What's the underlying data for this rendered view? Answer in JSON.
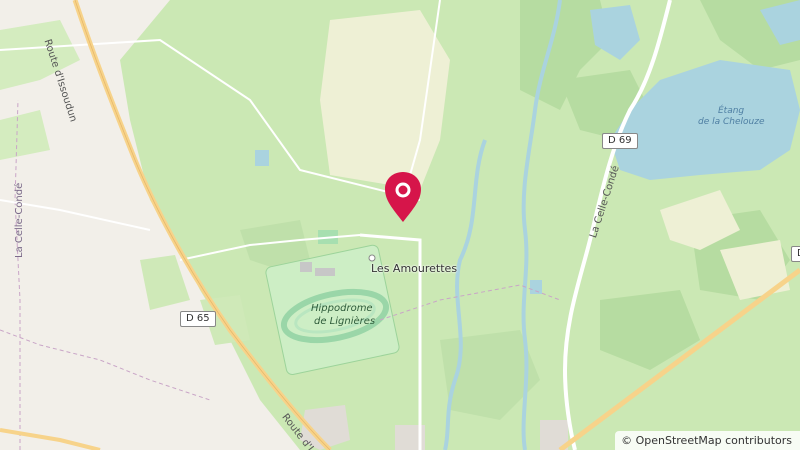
{
  "map": {
    "attribution": {
      "symbol": "©",
      "text": "OpenStreetMap contributors"
    },
    "labels": {
      "road_issoudun_top": "Route d'Issoudun",
      "road_issoudun_bottom": "Route d'I",
      "la_celle_conde_left": "La Celle-Condé",
      "la_celle_conde_right": "La Celle-Condé",
      "les_amourettes": "Les Amourettes",
      "hippodrome_line1": "Hippodrome",
      "hippodrome_line2": "de Lignières",
      "etang_line1": "Étang",
      "etang_line2": "de la Chelouze"
    },
    "road_shields": {
      "d65": "D 65",
      "d69": "D 69",
      "edge": "D"
    },
    "marker": {
      "icon": "map-pin-icon",
      "color": "#d6154a"
    },
    "colors": {
      "field": "#c8e8b0",
      "meadow": "#d9ecc6",
      "forest": "#b5dca0",
      "water": "#aad3df",
      "farmland": "#eef0d5",
      "urban": "#e0dcd6",
      "road_primary": "#f7d38a",
      "base": "#f2efe9"
    }
  }
}
